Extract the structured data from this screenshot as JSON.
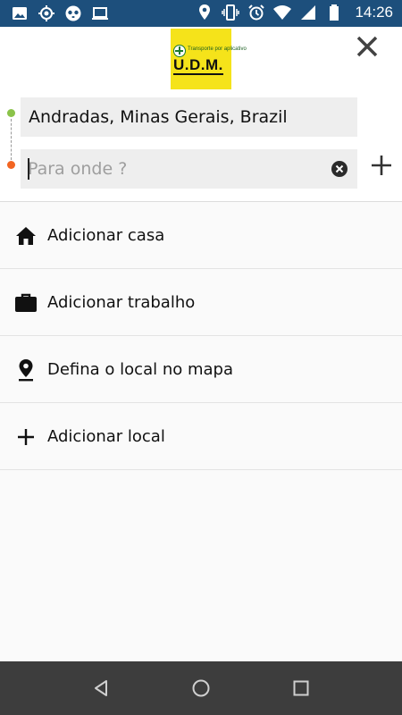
{
  "status_bar": {
    "time": "14:26",
    "left_icons": [
      "image-icon",
      "location-target-icon",
      "panda-app-icon",
      "laptop-icon"
    ],
    "right_icons": [
      "location-pin-icon",
      "vibrate-icon",
      "alarm-icon",
      "wifi-icon",
      "signal-icon",
      "battery-icon"
    ]
  },
  "header": {
    "logo": {
      "tagline": "Transporte por aplicativo",
      "name": "U.D.M."
    },
    "close_icon": "close-icon"
  },
  "route": {
    "origin": {
      "value": "Andradas, Minas Gerais, Brazil",
      "dot_color": "#8bc34a"
    },
    "destination": {
      "value": "",
      "placeholder": "Para onde ?",
      "dot_color": "#f26522"
    },
    "clear_icon": "clear-circle-icon",
    "add_stop_icon": "plus-icon"
  },
  "list": {
    "items": [
      {
        "label": "Adicionar casa",
        "icon": "home-icon"
      },
      {
        "label": "Adicionar trabalho",
        "icon": "briefcase-icon"
      },
      {
        "label": "Defina o local no mapa",
        "icon": "map-pin-icon"
      },
      {
        "label": "Adicionar local",
        "icon": "plus-icon"
      }
    ]
  },
  "nav_bar": {
    "buttons": [
      "back-icon",
      "home-circle-icon",
      "recents-square-icon"
    ]
  },
  "colors": {
    "status_bar_bg": "#1d4f7c",
    "logo_bg": "#f5e31a",
    "field_bg": "#eeeeee",
    "nav_bar_bg": "#3d3d3d"
  }
}
